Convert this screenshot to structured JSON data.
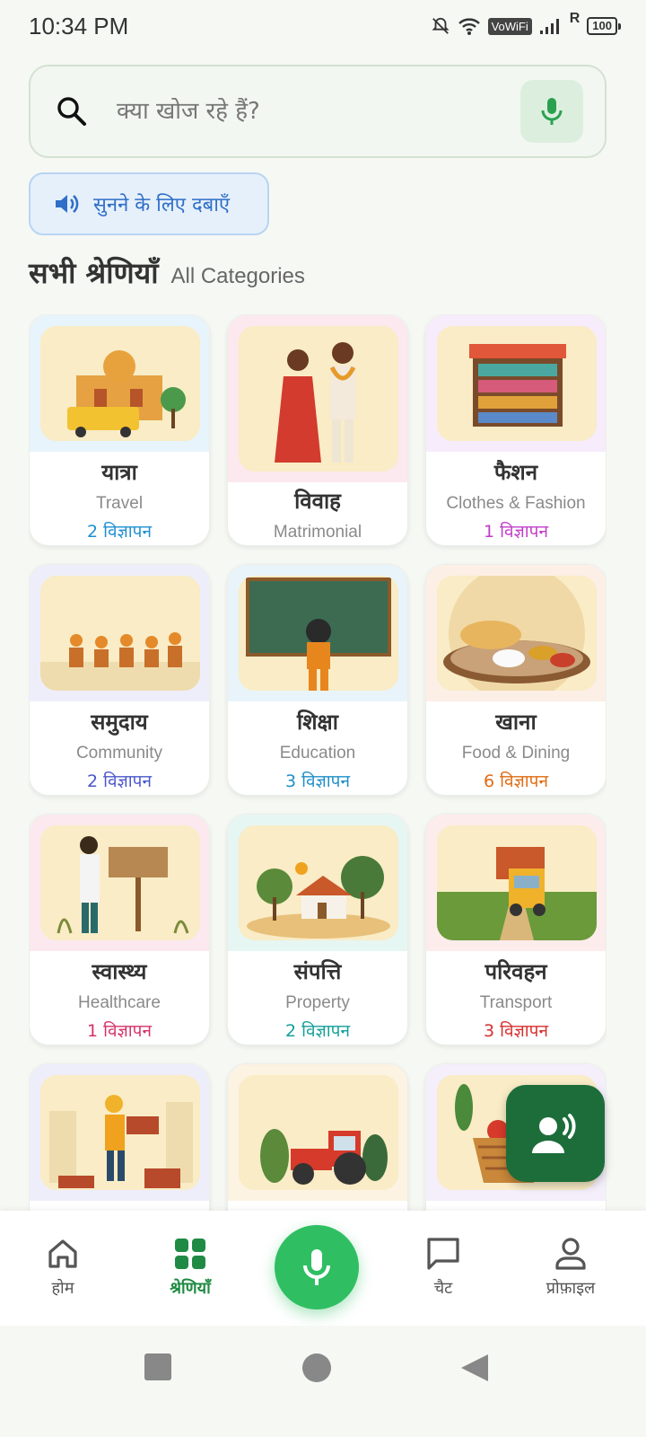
{
  "status": {
    "time": "10:34 PM",
    "vowifi": "VoWiFi",
    "roaming": "R",
    "battery": "100"
  },
  "search": {
    "placeholder": "क्या खोज रहे हैं?",
    "icon": "search-icon",
    "mic_icon": "microphone-icon"
  },
  "listen": {
    "label": "सुनने के लिए दबाएँ",
    "icon": "speaker-icon"
  },
  "section": {
    "title": "सभी श्रेणियाँ",
    "subtitle": "All Categories"
  },
  "categories": [
    {
      "hi": "यात्रा",
      "en": "Travel",
      "count": "2 विज्ञापन",
      "color": "#1f8fd1",
      "bg": "#e8f4fb"
    },
    {
      "hi": "विवाह",
      "en": "Matrimonial",
      "count": "",
      "color": "#d14a7a",
      "bg": "#fbe9ef"
    },
    {
      "hi": "फैशन",
      "en": "Clothes & Fashion",
      "count": "1 विज्ञापन",
      "color": "#c03cc9",
      "bg": "#f7ecfb"
    },
    {
      "hi": "समुदाय",
      "en": "Community",
      "count": "2 विज्ञापन",
      "color": "#4b57c9",
      "bg": "#eeeefb"
    },
    {
      "hi": "शिक्षा",
      "en": "Education",
      "count": "3 विज्ञापन",
      "color": "#1f8fc9",
      "bg": "#e8f4fa"
    },
    {
      "hi": "खाना",
      "en": "Food & Dining",
      "count": "6 विज्ञापन",
      "color": "#e06b12",
      "bg": "#fcefe6"
    },
    {
      "hi": "स्वास्थ्य",
      "en": "Healthcare",
      "count": "1 विज्ञापन",
      "color": "#d5336a",
      "bg": "#fbe9ef"
    },
    {
      "hi": "संपत्ति",
      "en": "Property",
      "count": "2 विज्ञापन",
      "color": "#14a09a",
      "bg": "#e6f6f3"
    },
    {
      "hi": "परिवहन",
      "en": "Transport",
      "count": "3 विज्ञापन",
      "color": "#d63030",
      "bg": "#fdecec"
    },
    {
      "hi": "",
      "en": "",
      "count": "",
      "color": "#555555",
      "bg": "#eeeefb"
    },
    {
      "hi": "",
      "en": "",
      "count": "",
      "color": "#555555",
      "bg": "#fcf3e3"
    },
    {
      "hi": "",
      "en": "",
      "count": "",
      "color": "#555555",
      "bg": "#f4effb"
    }
  ],
  "nav": {
    "home": "होम",
    "categories": "श्रेणियाँ",
    "chat": "चैट",
    "profile": "प्रोफ़ाइल"
  },
  "colors": {
    "accent": "#1f8a43",
    "fab": "#1c6d3a",
    "mic": "#2fbf62"
  }
}
